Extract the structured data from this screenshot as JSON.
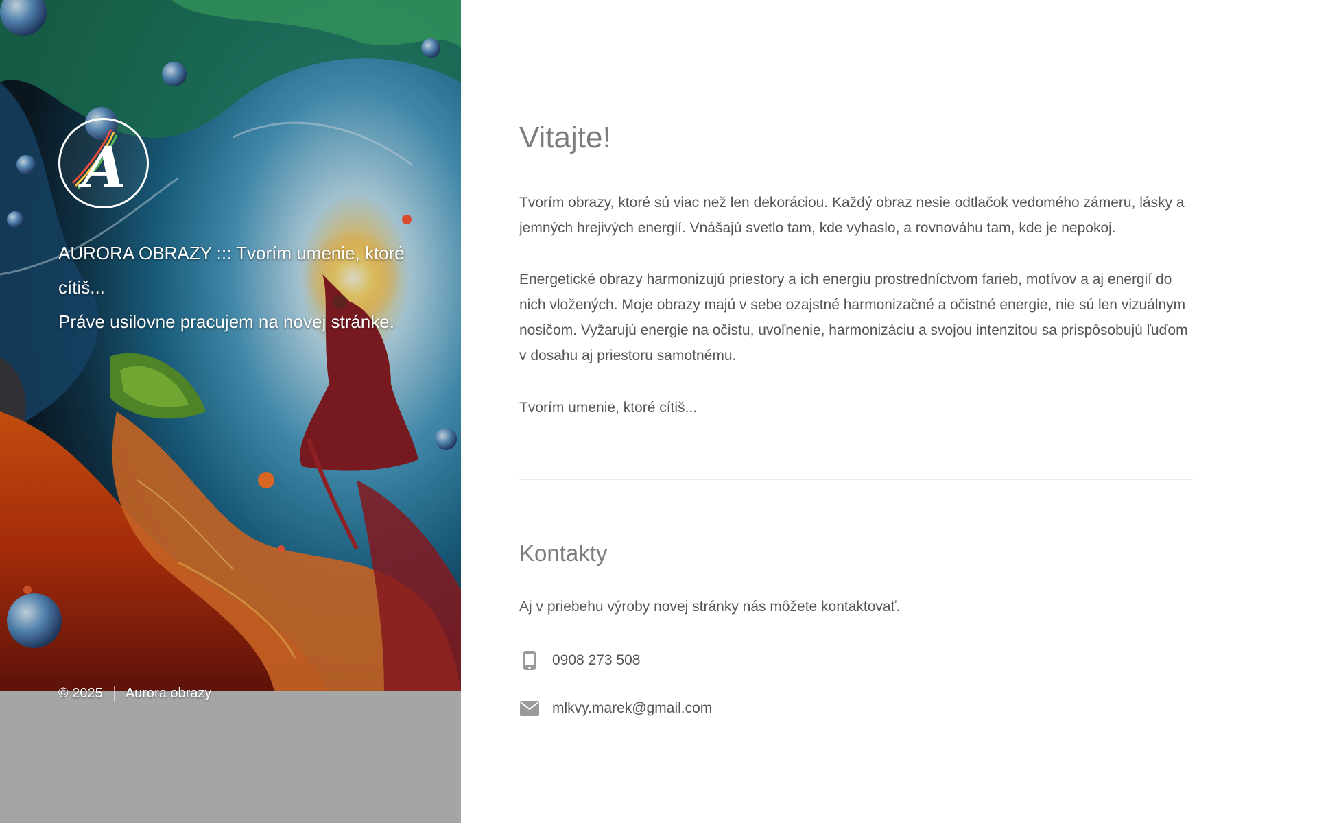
{
  "sidebar": {
    "logo_letter": "A",
    "tagline_line1": "AURORA OBRAZY ::: Tvorím umenie, ktoré cítiš...",
    "tagline_line2": "Práve usilovne pracujem na novej stránke.",
    "footer_copyright": "© 2025",
    "footer_name": "Aurora obrazy"
  },
  "main": {
    "welcome_heading": "Vitajte!",
    "paragraph1": "Tvorím obrazy, ktoré sú viac než len dekoráciou. Každý obraz nesie odtlačok vedomého zámeru, lásky a jemných hrejivých energií. Vnášajú svetlo tam, kde vyhaslo, a rovnováhu tam, kde je nepokoj.",
    "paragraph2": "Energetické obrazy harmonizujú priestory a ich energiu prostredníctvom farieb, motívov a aj energií do nich vložených. Moje obrazy majú v sebe ozajstné harmonizačné a očistné energie, nie sú len vizuálnym nosičom. Vyžarujú energie na očistu, uvoľnenie, harmonizáciu a svojou intenzitou sa prispôsobujú ľuďom v dosahu aj priestoru samotnému.",
    "paragraph3": "Tvorím umenie, ktoré cítiš...",
    "contacts_heading": "Kontakty",
    "contacts_text": "Aj v priebehu výroby novej stránky nás môžete kontaktovať.",
    "phone": "0908 273 508",
    "email": "mlkvy.marek@gmail.com"
  },
  "icons": {
    "phone": "mobile-phone-icon",
    "email": "envelope-icon"
  },
  "colors": {
    "sidebar_gray": "#a5a5a5",
    "heading_gray": "#7d7d7d",
    "text_gray": "#555555",
    "icon_gray": "#9a9a9a"
  }
}
